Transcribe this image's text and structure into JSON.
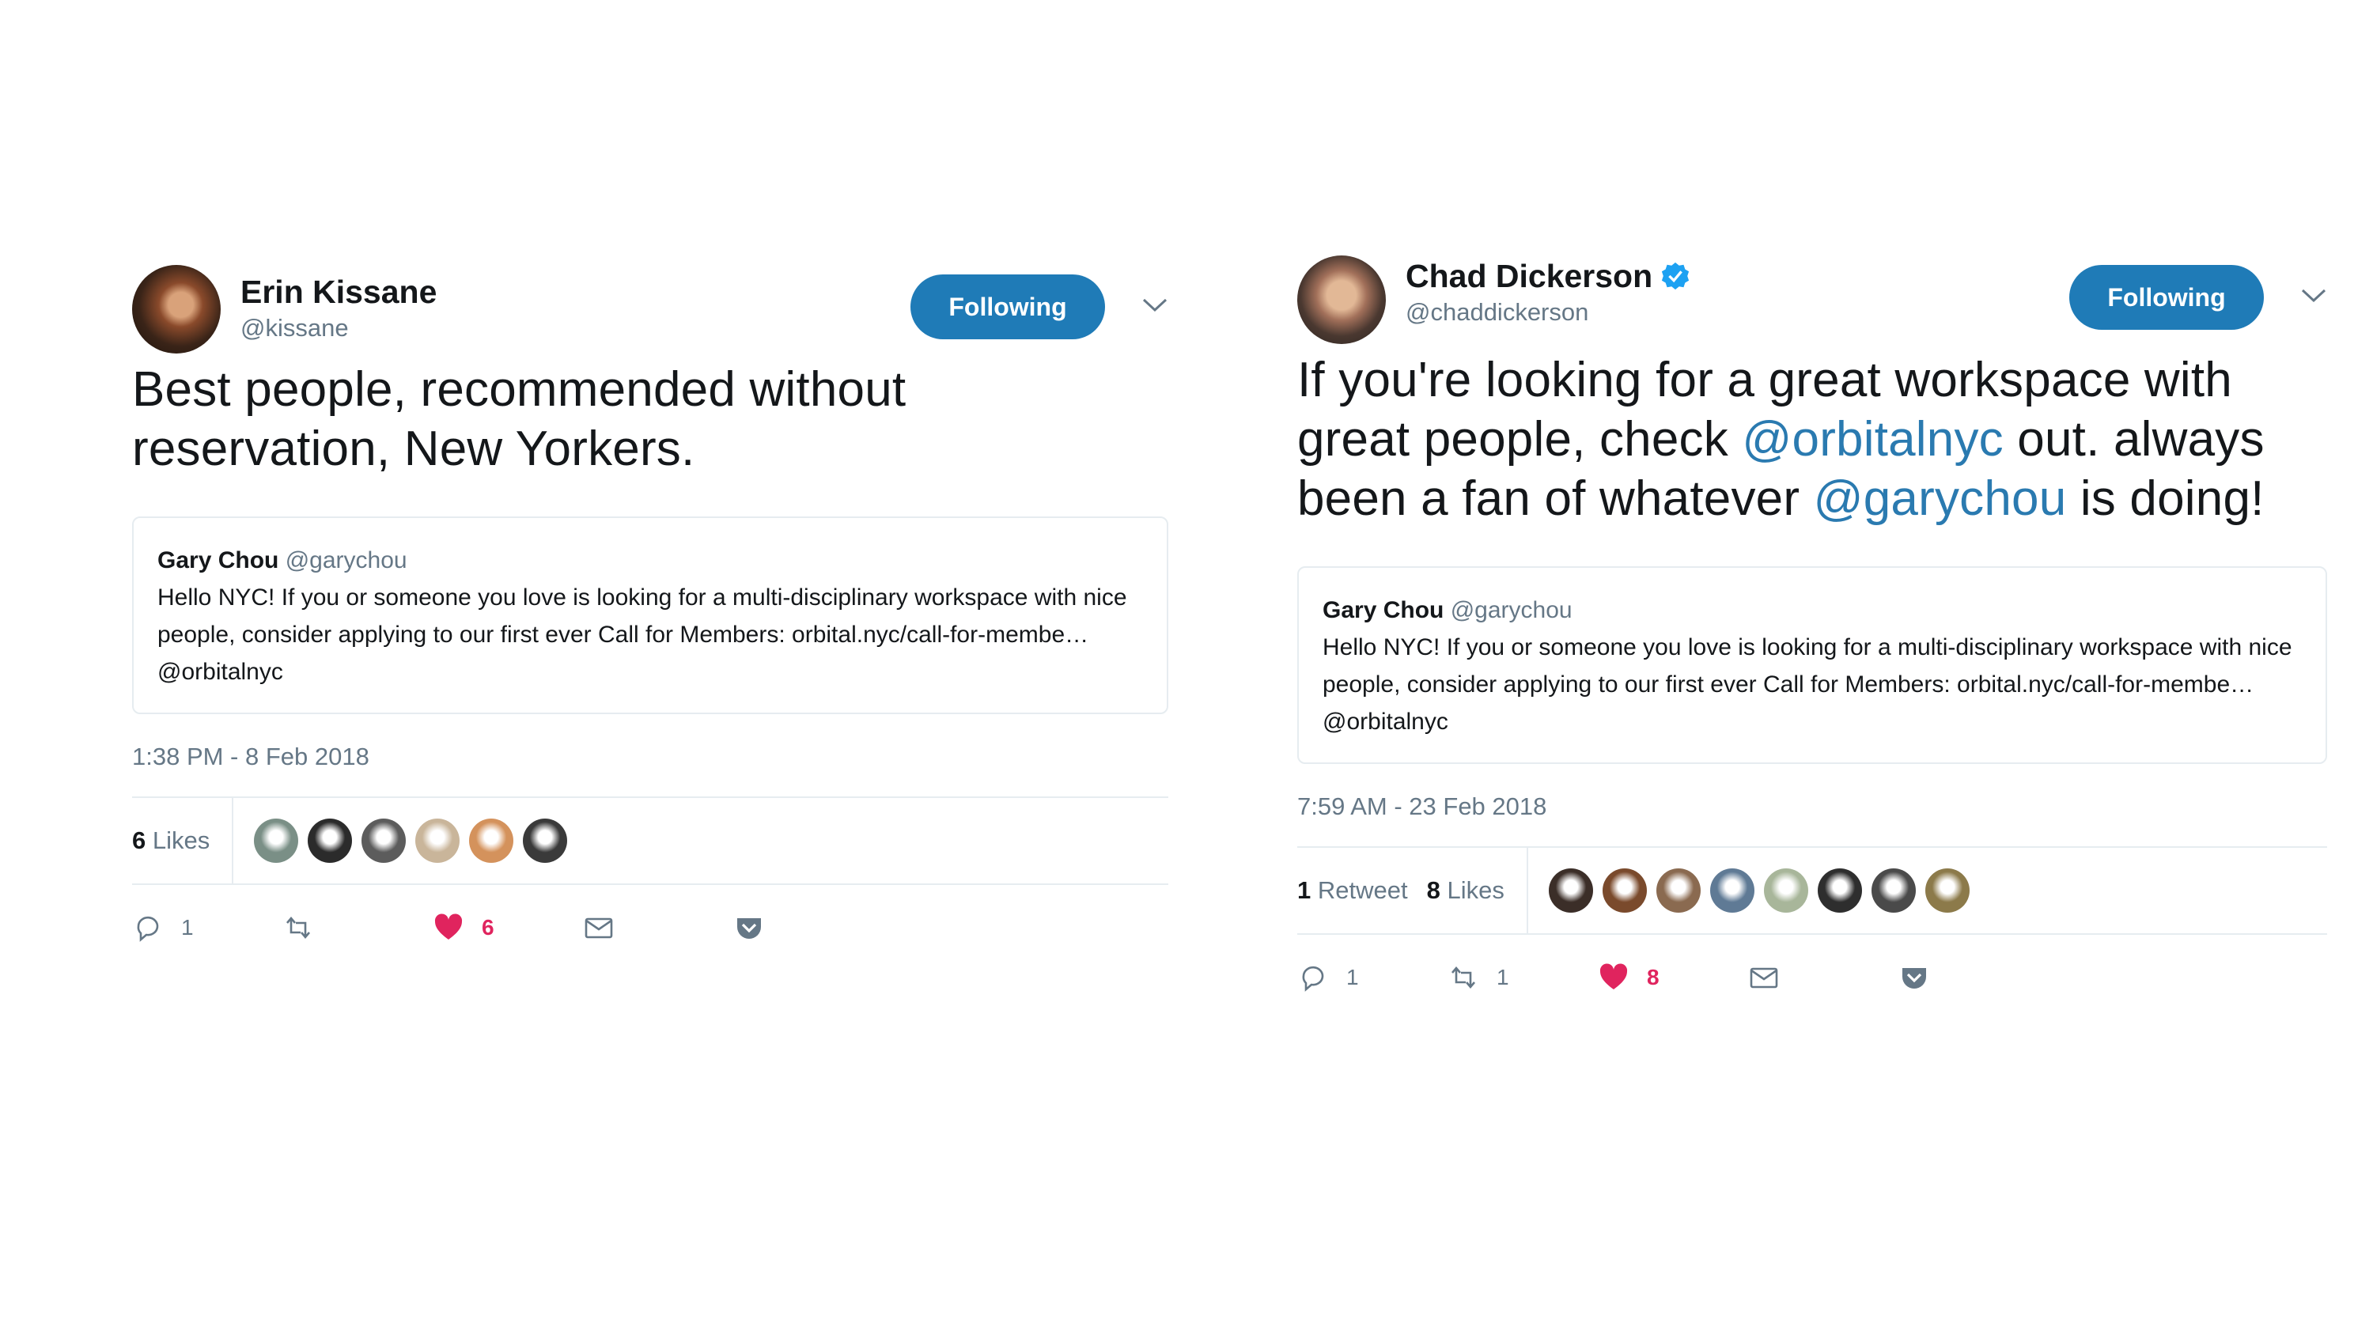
{
  "tweets": [
    {
      "display_name": "Erin Kissane",
      "handle": "@kissane",
      "verified": false,
      "follow_label": "Following",
      "text_parts": [
        "Best people, recommended without reservation, New Yorkers."
      ],
      "quote": {
        "name": "Gary Chou",
        "handle": "@garychou",
        "text": "Hello NYC! If you or someone you love is looking for a multi-disciplinary workspace with nice people, consider applying to our first ever Call for Members: orbital.nyc/call-for-membe… @orbitalnyc"
      },
      "timestamp": "1:38 PM - 8 Feb 2018",
      "stats": {
        "likes_count": "6",
        "likes_label": "Likes"
      },
      "liker_colors": [
        "#7a8f86",
        "#2b2b2b",
        "#5c5c5c",
        "#c9b59a",
        "#d4925c",
        "#3a3a3a"
      ],
      "actions": {
        "reply_count": "1",
        "retweet_count": "",
        "like_count": "6"
      }
    },
    {
      "display_name": "Chad Dickerson",
      "handle": "@chaddickerson",
      "verified": true,
      "follow_label": "Following",
      "text_before": "If you're looking for a great workspace with great people, check ",
      "mention1": "@orbitalnyc",
      "text_middle": " out. always been a fan of whatever ",
      "mention2": "@garychou",
      "text_after": " is doing!",
      "quote": {
        "name": "Gary Chou",
        "handle": "@garychou",
        "text": "Hello NYC! If you or someone you love is looking for a multi-disciplinary workspace with nice people, consider applying to our first ever Call for Members: orbital.nyc/call-for-membe… @orbitalnyc"
      },
      "timestamp": "7:59 AM - 23 Feb 2018",
      "stats": {
        "retweets_count": "1",
        "retweets_label": "Retweet",
        "likes_count": "8",
        "likes_label": "Likes"
      },
      "liker_colors": [
        "#3b2e28",
        "#7a4a2c",
        "#8a6a50",
        "#5f7a95",
        "#a8b69a",
        "#2e2e2e",
        "#4a4a4a",
        "#8c7a4a"
      ],
      "actions": {
        "reply_count": "1",
        "retweet_count": "1",
        "like_count": "8"
      }
    }
  ],
  "colors": {
    "accent": "#1f7bb7",
    "like": "#e0245e",
    "muted": "#657786"
  }
}
